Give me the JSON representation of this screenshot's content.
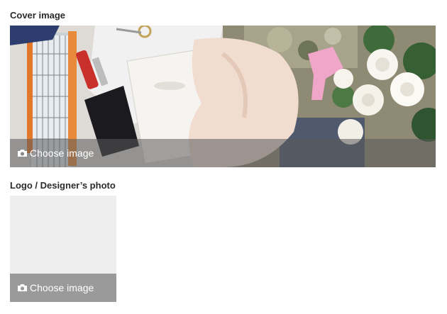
{
  "cover": {
    "label": "Cover image",
    "choose_label": "Choose image",
    "icon": "camera-icon"
  },
  "logo": {
    "label": "Logo / Designer’s photo",
    "choose_label": "Choose image",
    "icon": "camera-icon"
  },
  "colors": {
    "overlay": "#5a5a5a",
    "placeholder_bg": "#eeeeee",
    "overlay_text": "#ffffff"
  }
}
